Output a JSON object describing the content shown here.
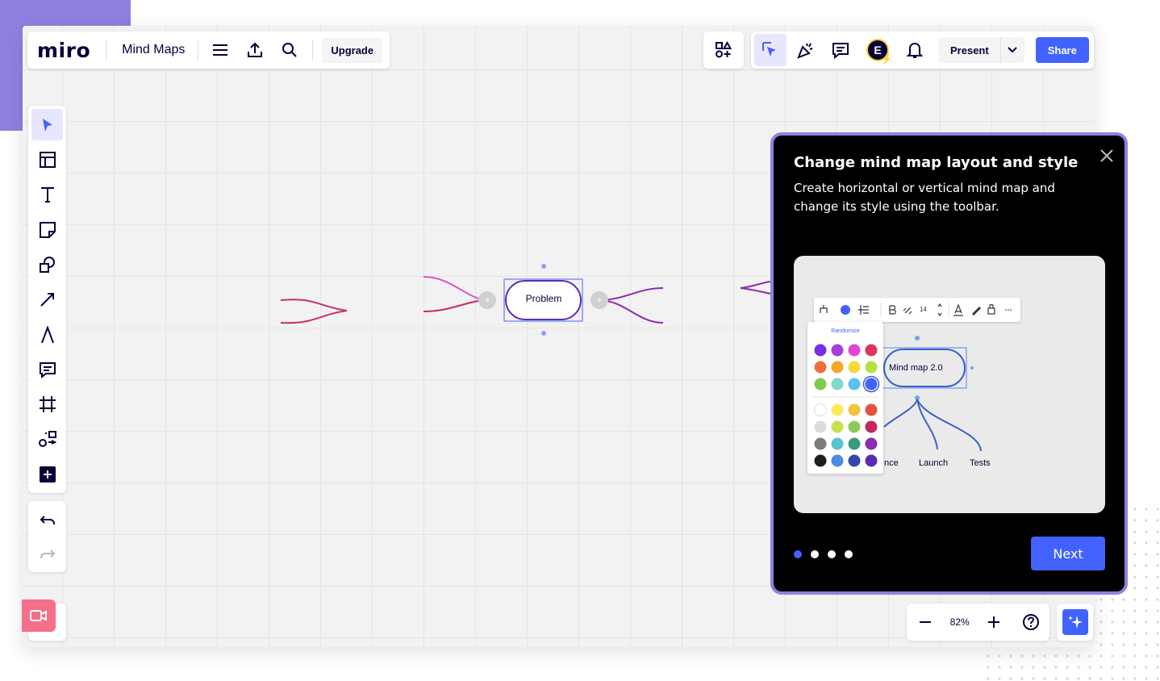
{
  "app": {
    "logo": "miro",
    "board_name": "Mind Maps",
    "upgrade_label": "Upgrade",
    "present_label": "Present",
    "share_label": "Share",
    "user_initial": "E",
    "accent_color": "#4262ff"
  },
  "toolbar_icons": {
    "top_left": [
      "menu-icon",
      "export-icon",
      "search-icon"
    ],
    "top_right": [
      "apps-icon",
      "reactions-select-icon",
      "celebrate-icon",
      "comments-icon",
      "avatar",
      "bell-icon",
      "chevron-down-icon"
    ],
    "left": [
      "select-cursor-icon",
      "templates-icon",
      "text-icon",
      "sticky-note-icon",
      "shapes-icon",
      "connection-line-icon",
      "pen-icon",
      "comment-icon",
      "frame-icon",
      "mind-map-icon",
      "plus-square-icon"
    ],
    "history": [
      "undo-icon",
      "redo-icon"
    ]
  },
  "canvas": {
    "node_label": "Problem"
  },
  "zoom": {
    "value": "82%"
  },
  "popup": {
    "title": "Change mind map layout and style",
    "description": "Create horizontal or vertical mind map and change its style using the toolbar.",
    "next_label": "Next",
    "step_current": 1,
    "step_total": 4,
    "border_color": "#8f80e0",
    "preview": {
      "randomize_label": "Randomize",
      "font_size": "14",
      "node_label": "Mind map 2.0",
      "children": [
        "nce",
        "Launch",
        "Tests"
      ],
      "palette_colors": [
        [
          "#7a2ee6",
          "#a83ee0",
          "#e645d2",
          "#e0345e"
        ],
        [
          "#f26b3a",
          "#f5a52c",
          "#f5d93b",
          "#b9e043"
        ],
        [
          "#7acc4a",
          "#7edbc8",
          "#5bc0f0",
          "#4262ff"
        ],
        [
          "#ffffff",
          "#f9ec5c",
          "#f4c13a",
          "#e5533a"
        ],
        [
          "#dcdcdc",
          "#c6e04e",
          "#8dc95c",
          "#c5285c"
        ],
        [
          "#7b7b7b",
          "#58c4cf",
          "#3a9a80",
          "#8a2cb0"
        ],
        [
          "#1f1f1f",
          "#4a8ce6",
          "#3246b0",
          "#5a2ab0"
        ]
      ]
    }
  }
}
